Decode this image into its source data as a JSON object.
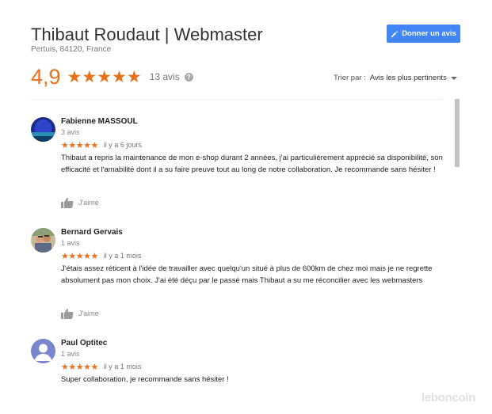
{
  "business": {
    "name": "Thibaut Roudaut | Webmaster",
    "address": "Pertuis, 84120, France"
  },
  "actions": {
    "write_review": "Donner un avis"
  },
  "summary": {
    "score": "4,9",
    "stars": "★★★★★",
    "rating_value": 4.9,
    "count": "13 avis",
    "help": "?"
  },
  "sort": {
    "label": "Trier par :",
    "value": "Avis les plus pertinents"
  },
  "reviews": [
    {
      "author": "Fabienne MASSOUL",
      "meta": "3 avis",
      "stars": "★★★★★",
      "rating": 5,
      "date": "il y a 6 jours",
      "text": "Thibaut a repris la maintenance de mon e-shop durant 2 années, j'ai particulièrement apprécié sa disponibilité, son efficacité et l'amabilité dont il a su faire preuve tout au long de notre collaboration. Je recommande sans hésiter !",
      "like": "J'aime"
    },
    {
      "author": "Bernard Gervais",
      "meta": "1 avis",
      "stars": "★★★★★",
      "rating": 5,
      "date": "il y a 1 mois",
      "text": "J'étais assez réticent à l'idée de travailler avec quelqu'un situé à plus de 600km de chez moi mais je ne regrette absolument pas mon choix. J'ai été déçu par le passé mais Thibaut a su me réconcilier avec les webmasters",
      "like": "J'aime"
    },
    {
      "author": "Paul Optitec",
      "meta": "1 avis",
      "stars": "★★★★★",
      "rating": 5,
      "date": "il y a 1 mois",
      "text": "Super collaboration, je recommande sans hésiter !"
    }
  ],
  "watermark": "leboncoin",
  "colors": {
    "star": "#e7711b",
    "button": "#4285f4"
  }
}
